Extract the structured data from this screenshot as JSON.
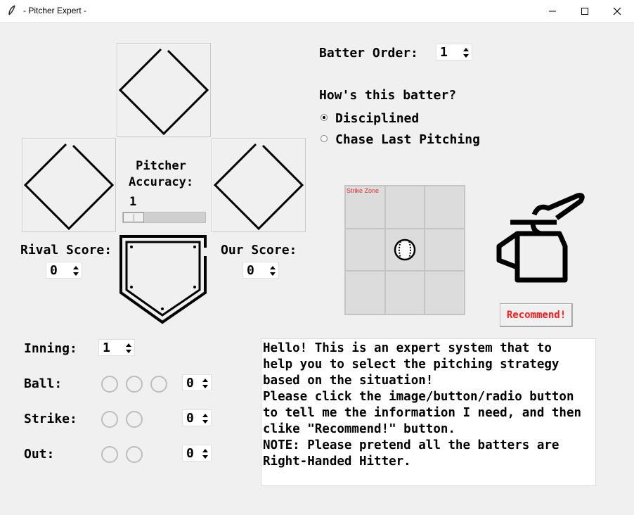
{
  "window": {
    "title": "- Pitcher Expert -"
  },
  "bases": {
    "pitcher_accuracy_label": "Pitcher\nAccuracy:",
    "pitcher_accuracy_value": "1",
    "pitcher_accuracy_level": 0
  },
  "scores": {
    "rival_label": "Rival Score:",
    "rival_value": "0",
    "our_label": "Our Score:",
    "our_value": "0"
  },
  "batter": {
    "order_label": "Batter Order:",
    "order_value": "1",
    "question": "How's this batter?",
    "options": [
      "Disciplined",
      "Chase Last Pitching"
    ],
    "selected": 0
  },
  "strike_zone": {
    "label": "Strike Zone"
  },
  "recommend_label": "Recommend!",
  "counts": {
    "inning_label": "Inning:",
    "inning_value": "1",
    "ball_label": "Ball:",
    "ball_value": "0",
    "strike_label": "Strike:",
    "strike_value": "0",
    "out_label": "Out:",
    "out_value": "0"
  },
  "message": "Hello! This is an expert system that to\nhelp you to select the pitching strategy\nbased on the situation!\nPlease click the image/button/radio button\nto tell me the information I need, and then\nclike \"Recommend!\" button.\nNOTE: Please pretend all the batters are\nRight-Handed Hitter.",
  "colors": {
    "recommend_text": "#ff1a1a",
    "strike_zone_label": "#e03030"
  }
}
